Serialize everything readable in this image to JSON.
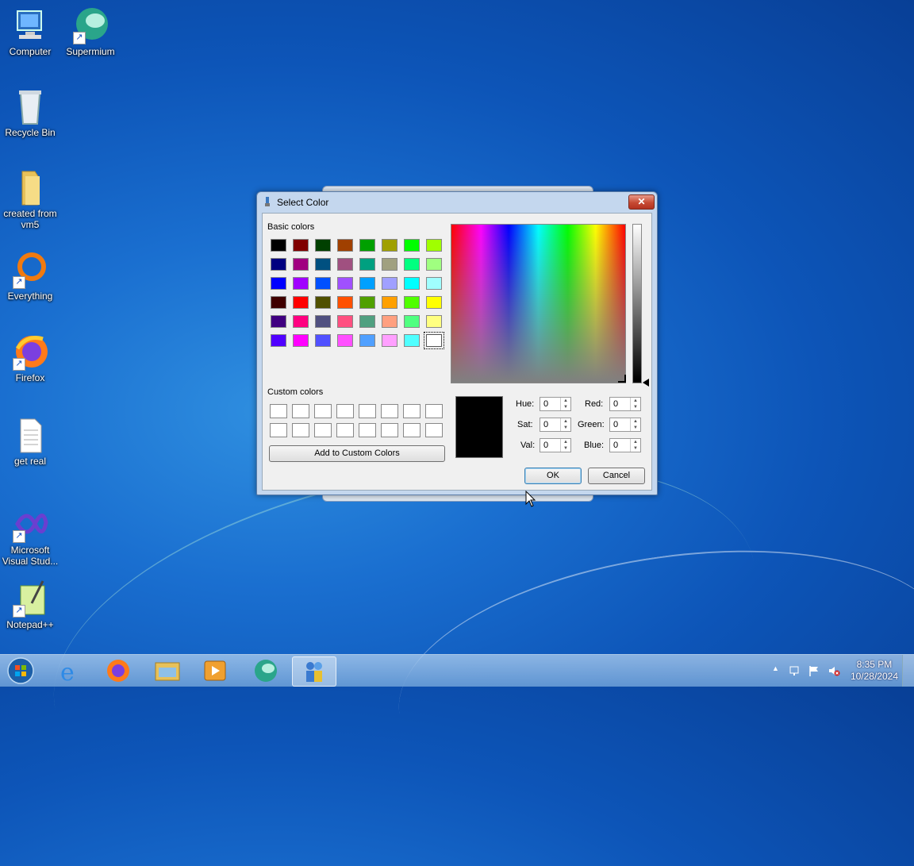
{
  "desktop": {
    "icons": [
      {
        "label": "Computer"
      },
      {
        "label": "Supermium"
      },
      {
        "label": "Recycle Bin"
      },
      {
        "label": "created from vm5"
      },
      {
        "label": "Everything"
      },
      {
        "label": "Firefox"
      },
      {
        "label": "get real"
      },
      {
        "label": "Microsoft Visual Stud..."
      },
      {
        "label": "Notepad++"
      }
    ]
  },
  "dialog": {
    "title": "Select Color",
    "close_label": "✕",
    "basic_colors_label": "Basic colors",
    "basic_colors": [
      "#000000",
      "#800000",
      "#004000",
      "#a04000",
      "#00a000",
      "#a0a000",
      "#00ff00",
      "#a0ff00",
      "#000080",
      "#a00080",
      "#005080",
      "#a05080",
      "#00a080",
      "#a0a080",
      "#00ff80",
      "#a0ff80",
      "#0000ff",
      "#a000ff",
      "#0050ff",
      "#a050ff",
      "#00a0ff",
      "#a0a0ff",
      "#00ffff",
      "#a0ffff",
      "#400000",
      "#ff0000",
      "#505000",
      "#ff5000",
      "#50a000",
      "#ffa000",
      "#50ff00",
      "#ffff00",
      "#400080",
      "#ff0080",
      "#505080",
      "#ff5080",
      "#50a080",
      "#ffa080",
      "#50ff80",
      "#ffff80",
      "#5000ff",
      "#ff00ff",
      "#5050ff",
      "#ff50ff",
      "#50a0ff",
      "#ffa0ff",
      "#50ffff",
      "#ffffff"
    ],
    "selected_basic_color": "#ffffff",
    "custom_colors_label": "Custom colors",
    "add_custom_label": "Add to Custom Colors",
    "fields": {
      "hue_label": "Hue:",
      "hue": "0",
      "sat_label": "Sat:",
      "sat": "0",
      "val_label": "Val:",
      "val": "0",
      "red_label": "Red:",
      "red": "0",
      "green_label": "Green:",
      "green": "0",
      "blue_label": "Blue:",
      "blue": "0"
    },
    "preview_color": "#000000",
    "ok_label": "OK",
    "cancel_label": "Cancel"
  },
  "taskbar": {
    "clock_time": "8:35 PM",
    "clock_date": "10/28/2024"
  }
}
